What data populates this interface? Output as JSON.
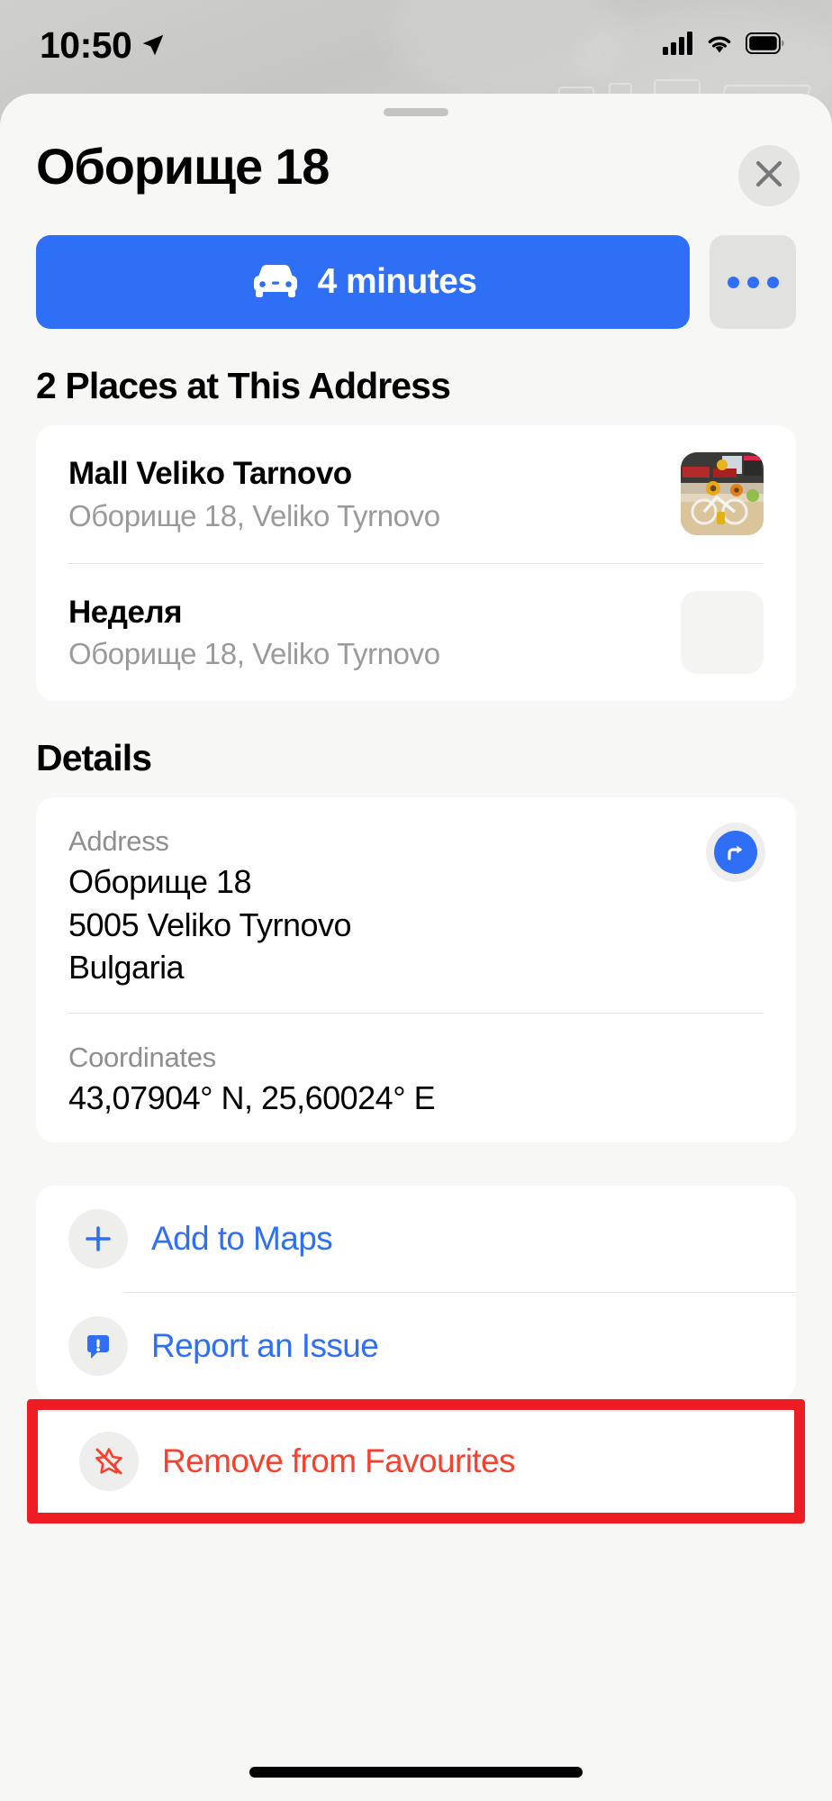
{
  "status_bar": {
    "time": "10:50",
    "location_arrow_icon": "location-arrow-icon",
    "cellular_icon": "cellular-signal-icon",
    "wifi_icon": "wifi-icon",
    "battery_icon": "battery-icon"
  },
  "sheet": {
    "title": "Оборище 18",
    "close_icon": "close-icon",
    "grabber": "drag-handle"
  },
  "actions": {
    "directions_label": "4 minutes",
    "directions_icon": "car-icon",
    "more_icon": "ellipsis-icon"
  },
  "places_section": {
    "heading": "2 Places at This Address",
    "items": [
      {
        "name": "Mall Veliko Tarnovo",
        "subtitle": "Оборище 18, Veliko Tyrnovo",
        "thumbnail": "mall-interior-photo"
      },
      {
        "name": "Неделя",
        "subtitle": "Оборище 18, Veliko Tyrnovo",
        "thumbnail": "empty-placeholder"
      }
    ]
  },
  "details_section": {
    "heading": "Details",
    "address": {
      "label": "Address",
      "line1": "Оборище 18",
      "line2": "5005 Veliko Tyrnovo",
      "line3": "Bulgaria",
      "directions_icon": "directions-arrow-icon"
    },
    "coordinates": {
      "label": "Coordinates",
      "value": "43,07904° N, 25,60024° E"
    }
  },
  "action_list": [
    {
      "label": "Add to Maps",
      "icon": "plus-icon",
      "style": "link"
    },
    {
      "label": "Report an Issue",
      "icon": "exclamation-bubble-icon",
      "style": "link"
    },
    {
      "label": "Remove from Favourites",
      "icon": "star-slash-icon",
      "style": "danger"
    }
  ],
  "colors": {
    "accent_blue": "#2f6ff5",
    "danger_red": "#f8402e",
    "highlight_red": "#ee1c23",
    "secondary_text": "#9a9a9a"
  }
}
